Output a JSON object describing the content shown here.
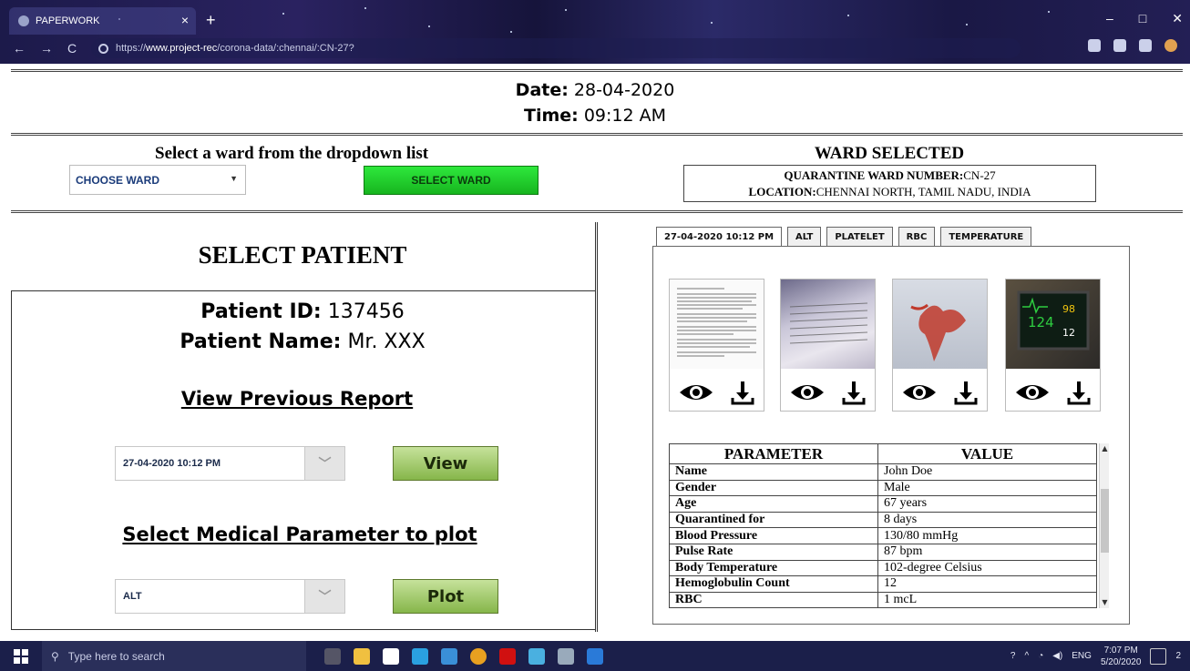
{
  "browser": {
    "tab_title": "PAPERWORK",
    "tab_close": "×",
    "new_tab": "+",
    "url_prefix": "https://",
    "url_domain": "www.project-rec",
    "url_path": "/corona-data/:chennai/:CN-27?",
    "window_controls": [
      "–",
      "□",
      "✕"
    ],
    "nav": [
      "←",
      "→",
      "C"
    ]
  },
  "header": {
    "date_label": "Date:",
    "date_value": "28-04-2020",
    "time_label": "Time:",
    "time_value": "09:12 AM"
  },
  "ward": {
    "prompt": "Select a ward from the dropdown list",
    "dropdown_value": "CHOOSE WARD",
    "select_button": "SELECT WARD",
    "selected_title": "WARD SELECTED",
    "number_label": "QUARANTINE WARD NUMBER:",
    "number_value": "CN-27",
    "location_label": "LOCATION:",
    "location_value": "CHENNAI NORTH, TAMIL NADU, INDIA"
  },
  "patient": {
    "section_title": "SELECT PATIENT",
    "id_label": "Patient ID:",
    "id_value": "137456",
    "name_label": "Patient Name:",
    "name_value": "Mr. XXX",
    "view_previous_heading": "View Previous Report",
    "report_select_value": "27-04-2020 10:12 PM",
    "view_button": "View",
    "param_heading": "Select Medical Parameter to plot",
    "param_select_value": "ALT",
    "plot_button": "Plot"
  },
  "report_tabs": [
    "27-04-2020 10:12 PM",
    "ALT",
    "PLATELET",
    "RBC",
    "TEMPERATURE"
  ],
  "documents": [
    {
      "name": "lab-report-document"
    },
    {
      "name": "prescription-document"
    },
    {
      "name": "xray-document"
    },
    {
      "name": "vitals-monitor-photo",
      "monitor_values": [
        "124",
        "98",
        "12"
      ]
    }
  ],
  "table": {
    "headers": [
      "PARAMETER",
      "VALUE"
    ],
    "rows": [
      [
        "Name",
        "John Doe"
      ],
      [
        "Gender",
        "Male"
      ],
      [
        "Age",
        "67 years"
      ],
      [
        "Quarantined for",
        "8 days"
      ],
      [
        "Blood Pressure",
        "130/80 mmHg"
      ],
      [
        "Pulse Rate",
        "87 bpm"
      ],
      [
        "Body Temperature",
        "102-degree Celsius"
      ],
      [
        "Hemoglobulin Count",
        "12"
      ],
      [
        "RBC",
        "1 mcL"
      ]
    ]
  },
  "taskbar": {
    "search_placeholder": "Type here to search",
    "lang": "ENG",
    "time": "7:07 PM",
    "date": "5/20/2020",
    "notifications": "2"
  }
}
